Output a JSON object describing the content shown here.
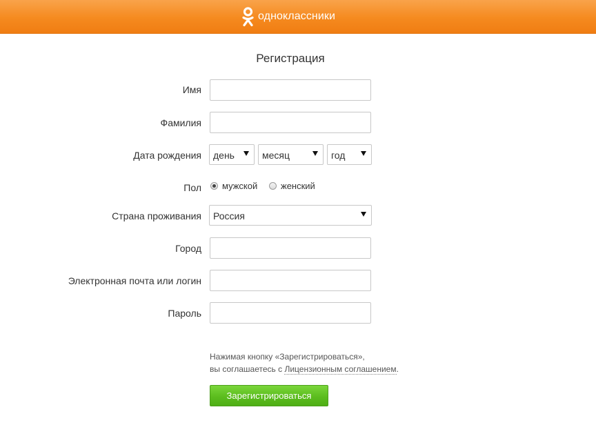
{
  "header": {
    "logo_text": "одноклассники",
    "color": "#f58a1f"
  },
  "form": {
    "title": "Регистрация",
    "first_name": {
      "label": "Имя",
      "value": ""
    },
    "last_name": {
      "label": "Фамилия",
      "value": ""
    },
    "birth_date": {
      "label": "Дата рождения",
      "day": "день",
      "month": "месяц",
      "year": "год"
    },
    "gender": {
      "label": "Пол",
      "options": [
        "мужской",
        "женский"
      ],
      "selected": "мужской"
    },
    "country": {
      "label": "Страна проживания",
      "value": "Россия"
    },
    "city": {
      "label": "Город",
      "value": ""
    },
    "email": {
      "label": "Электронная почта или логин",
      "value": ""
    },
    "password": {
      "label": "Пароль",
      "value": ""
    },
    "agreement": {
      "line1": "Нажимая кнопку «Зарегистрироваться»,",
      "line2_prefix": "вы соглашаетесь с ",
      "link": "Лицензионным соглашением",
      "line2_suffix": "."
    },
    "submit_label": "Зарегистрироваться",
    "submit_color": "#5cbd1e"
  }
}
